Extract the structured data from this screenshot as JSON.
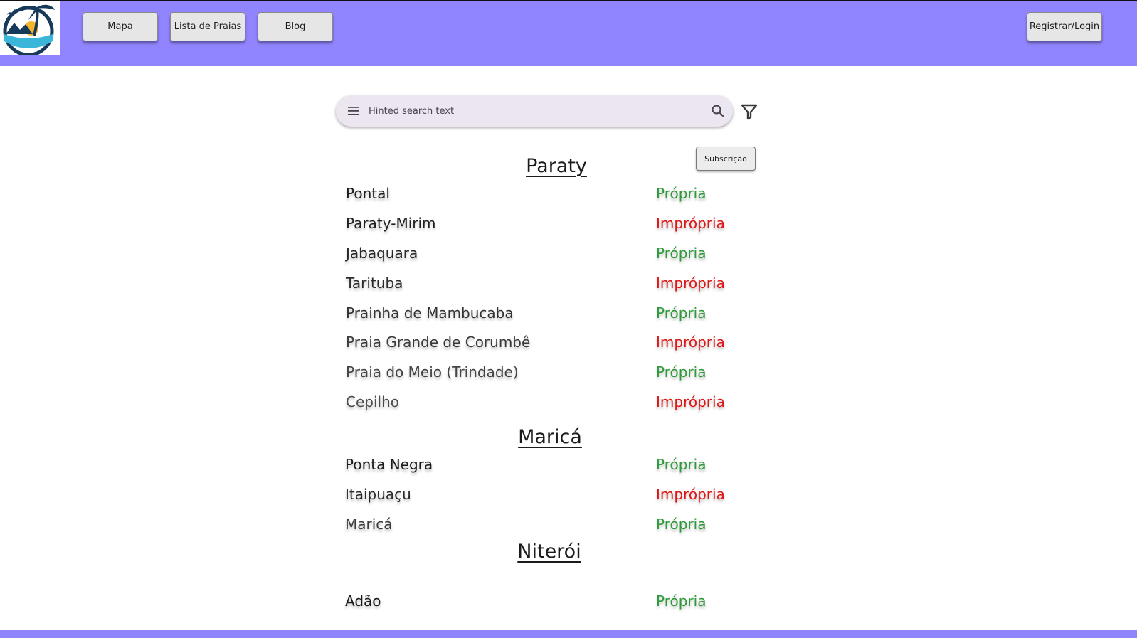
{
  "colors": {
    "header": "#9185ff",
    "status_propria": "#2e9a3a",
    "status_impropria": "#e01616"
  },
  "nav": {
    "mapa": "Mapa",
    "lista": "Lista de Praias",
    "blog": "Blog",
    "login": "Registrar/Login"
  },
  "search": {
    "placeholder": "Hinted search text",
    "menu_icon": "menu-icon",
    "search_icon": "search-icon",
    "filter_icon": "filter-icon"
  },
  "subscribe_label": "Subscrição",
  "cities": [
    {
      "name": "Paraty",
      "beaches": [
        {
          "name": "Pontal",
          "status": "Própria"
        },
        {
          "name": "Paraty-Mirim",
          "status": "Imprópria"
        },
        {
          "name": "Jabaquara",
          "status": "Própria"
        },
        {
          "name": "Tarituba",
          "status": "Imprópria"
        },
        {
          "name": "Prainha de Mambucaba",
          "status": "Própria"
        },
        {
          "name": "Praia Grande de Corumbê",
          "status": "Imprópria"
        },
        {
          "name": "Praia do Meio (Trindade)",
          "status": "Própria"
        },
        {
          "name": "Cepilho",
          "status": "Imprópria"
        }
      ]
    },
    {
      "name": "Maricá",
      "beaches": [
        {
          "name": "Ponta Negra",
          "status": "Própria"
        },
        {
          "name": "Itaipuaçu",
          "status": "Imprópria"
        },
        {
          "name": "Maricá",
          "status": "Própria"
        }
      ]
    },
    {
      "name": "Niterói",
      "beaches": [
        {
          "name": "Adão",
          "status": "Própria"
        }
      ]
    }
  ]
}
